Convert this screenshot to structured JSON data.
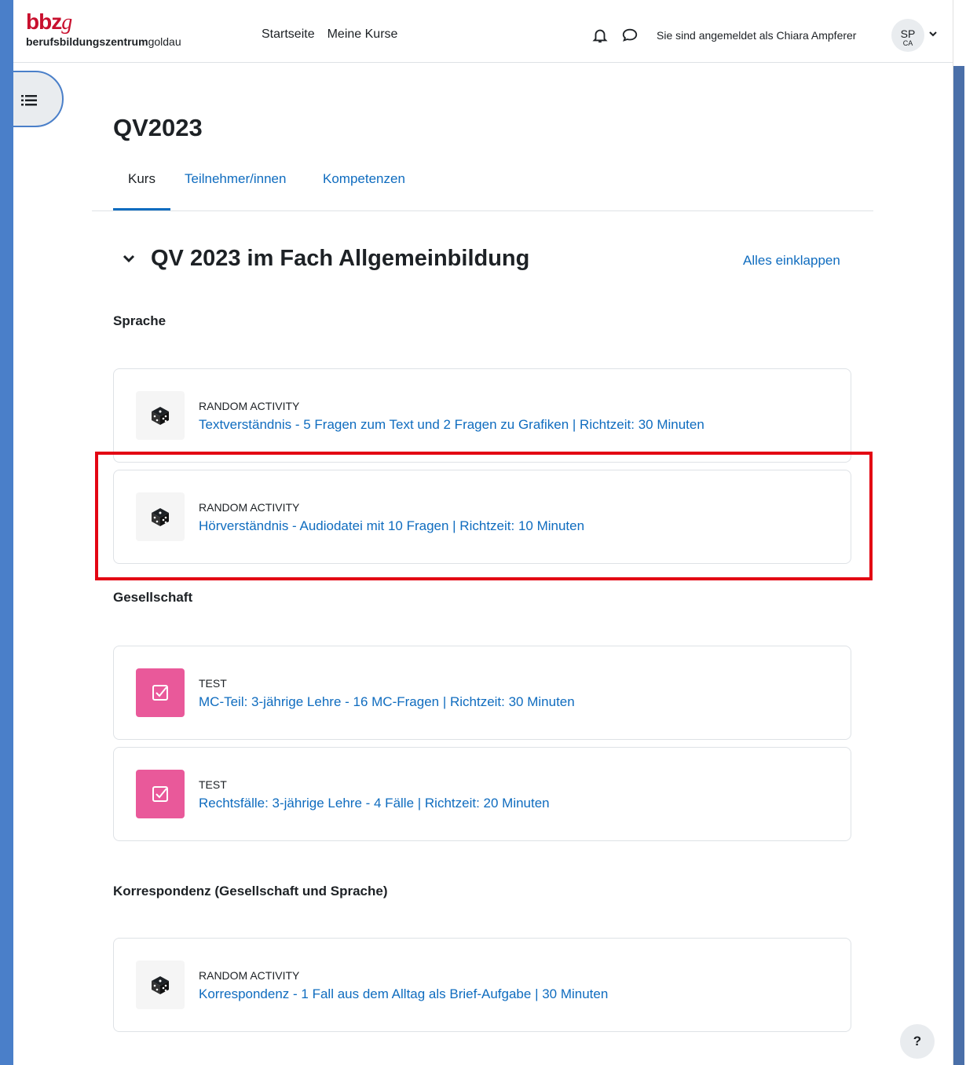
{
  "header": {
    "logo_mark": "bbz",
    "logo_mark_italic": "g",
    "logo_text_bold": "berufsbildungszentrum",
    "logo_text_light": "goldau",
    "nav": [
      "Startseite",
      "Meine Kurse"
    ],
    "user_text": "Sie sind angemeldet als Chiara Ampferer",
    "avatar_initials": "SP",
    "avatar_sub": "CA"
  },
  "course": {
    "title": "QV2023",
    "tabs": [
      "Kurs",
      "Teilnehmer/innen",
      "Kompetenzen"
    ],
    "active_tab": "Kurs"
  },
  "section": {
    "title": "QV 2023 im Fach Allgemeinbildung",
    "collapse_all": "Alles einklappen"
  },
  "groups": [
    {
      "heading": "Sprache",
      "items": [
        {
          "type": "RANDOM ACTIVITY",
          "title": "Textverständnis - 5 Fragen zum Text und 2 Fragen zu Grafiken | Richtzeit: 30 Minuten",
          "icon": "dice-icon"
        },
        {
          "type": "RANDOM ACTIVITY",
          "title": "Hörverständnis - Audiodatei mit 10 Fragen | Richtzeit: 10 Minuten",
          "icon": "dice-icon"
        }
      ]
    },
    {
      "heading": "Gesellschaft",
      "items": [
        {
          "type": "TEST",
          "title": "MC-Teil: 3-jährige Lehre - 16 MC-Fragen | Richtzeit: 30 Minuten",
          "icon": "quiz-check-icon"
        },
        {
          "type": "TEST",
          "title": "Rechtsfälle: 3-jährige Lehre - 4 Fälle | Richtzeit: 20 Minuten",
          "icon": "quiz-check-icon"
        }
      ]
    },
    {
      "heading": "Korrespondenz (Gesellschaft und Sprache)",
      "items": [
        {
          "type": "RANDOM ACTIVITY",
          "title": "Korrespondenz - 1 Fall aus dem Alltag als Brief-Aufgabe | 30 Minuten",
          "icon": "dice-icon"
        }
      ]
    }
  ],
  "help": {
    "label": "?"
  },
  "colors": {
    "link": "#0f6cbf",
    "brand": "#c8102e",
    "quiz_icon_bg": "#e9599a",
    "highlight": "#e30613",
    "background": "#4a7fc9"
  }
}
